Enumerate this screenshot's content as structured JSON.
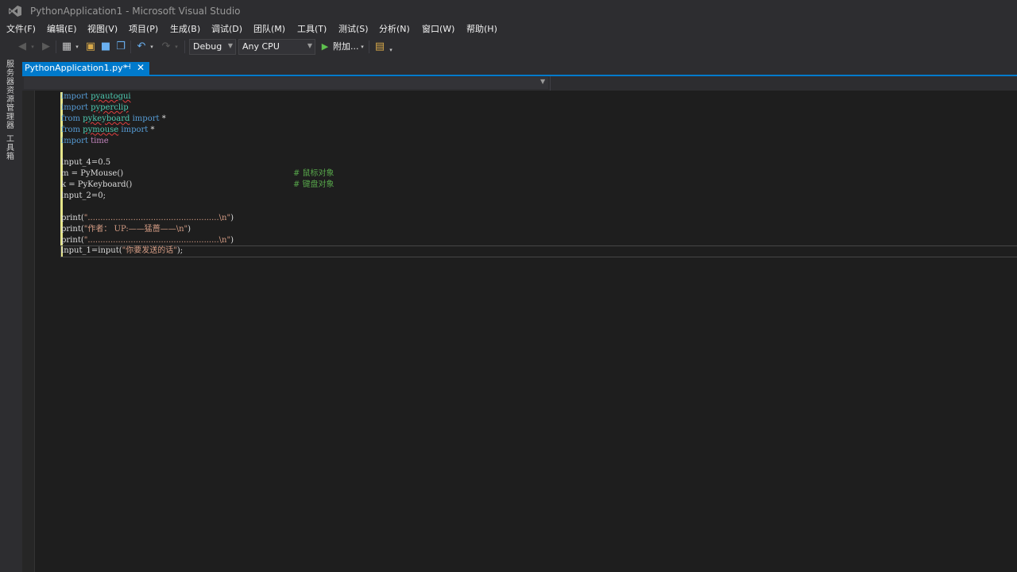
{
  "window": {
    "title": "PythonApplication1 - Microsoft Visual Studio"
  },
  "menu": [
    "文件(F)",
    "编辑(E)",
    "视图(V)",
    "项目(P)",
    "生成(B)",
    "调试(D)",
    "团队(M)",
    "工具(T)",
    "测试(S)",
    "分析(N)",
    "窗口(W)",
    "帮助(H)"
  ],
  "toolbar": {
    "config": "Debug",
    "platform": "Any CPU",
    "attach_label": "附加..."
  },
  "side_tabs": [
    "服务器资源管理器",
    "工具箱"
  ],
  "tab": {
    "label": "PythonApplication1.py*"
  },
  "code": {
    "l1_kw": "import",
    "l1_mod": "pyautogui",
    "l2_kw": "import",
    "l2_mod": "pyperclip",
    "l3_kw": "from",
    "l3_mod": "pykeyboard",
    "l3_kw2": "import",
    "l3_rest": "*",
    "l4_kw": "from",
    "l4_mod": "pymouse",
    "l4_kw2": "import",
    "l4_rest": "*",
    "l5_kw": "import",
    "l5_mod": "time",
    "l7_text": "lnput_4=0.5",
    "l8_text": "m = PyMouse()",
    "l8_comment": "# 鼠标对象",
    "l9_text": "k = PyKeyboard()",
    "l9_comment": "# 键盘对象",
    "l10_text": "lnput_2=0;",
    "l12_fn": "print(",
    "l12_str": "\"....................................................\\n\"",
    "l12_end": ")",
    "l13_fn": "print(",
    "l13_str": "\"作者： UP:——猛蔷——\\n\"",
    "l13_end": ")",
    "l14_fn": "print(",
    "l14_str": "\"....................................................\\n\"",
    "l14_end": ")",
    "l15_fn": "input_1=input(",
    "l15_str": "\"你要发送的话\"",
    "l15_end": ");"
  },
  "colors": {
    "accent": "#007acc",
    "background": "#1e1e1e",
    "chrome": "#2d2d30",
    "changebar": "#e5e58a"
  }
}
